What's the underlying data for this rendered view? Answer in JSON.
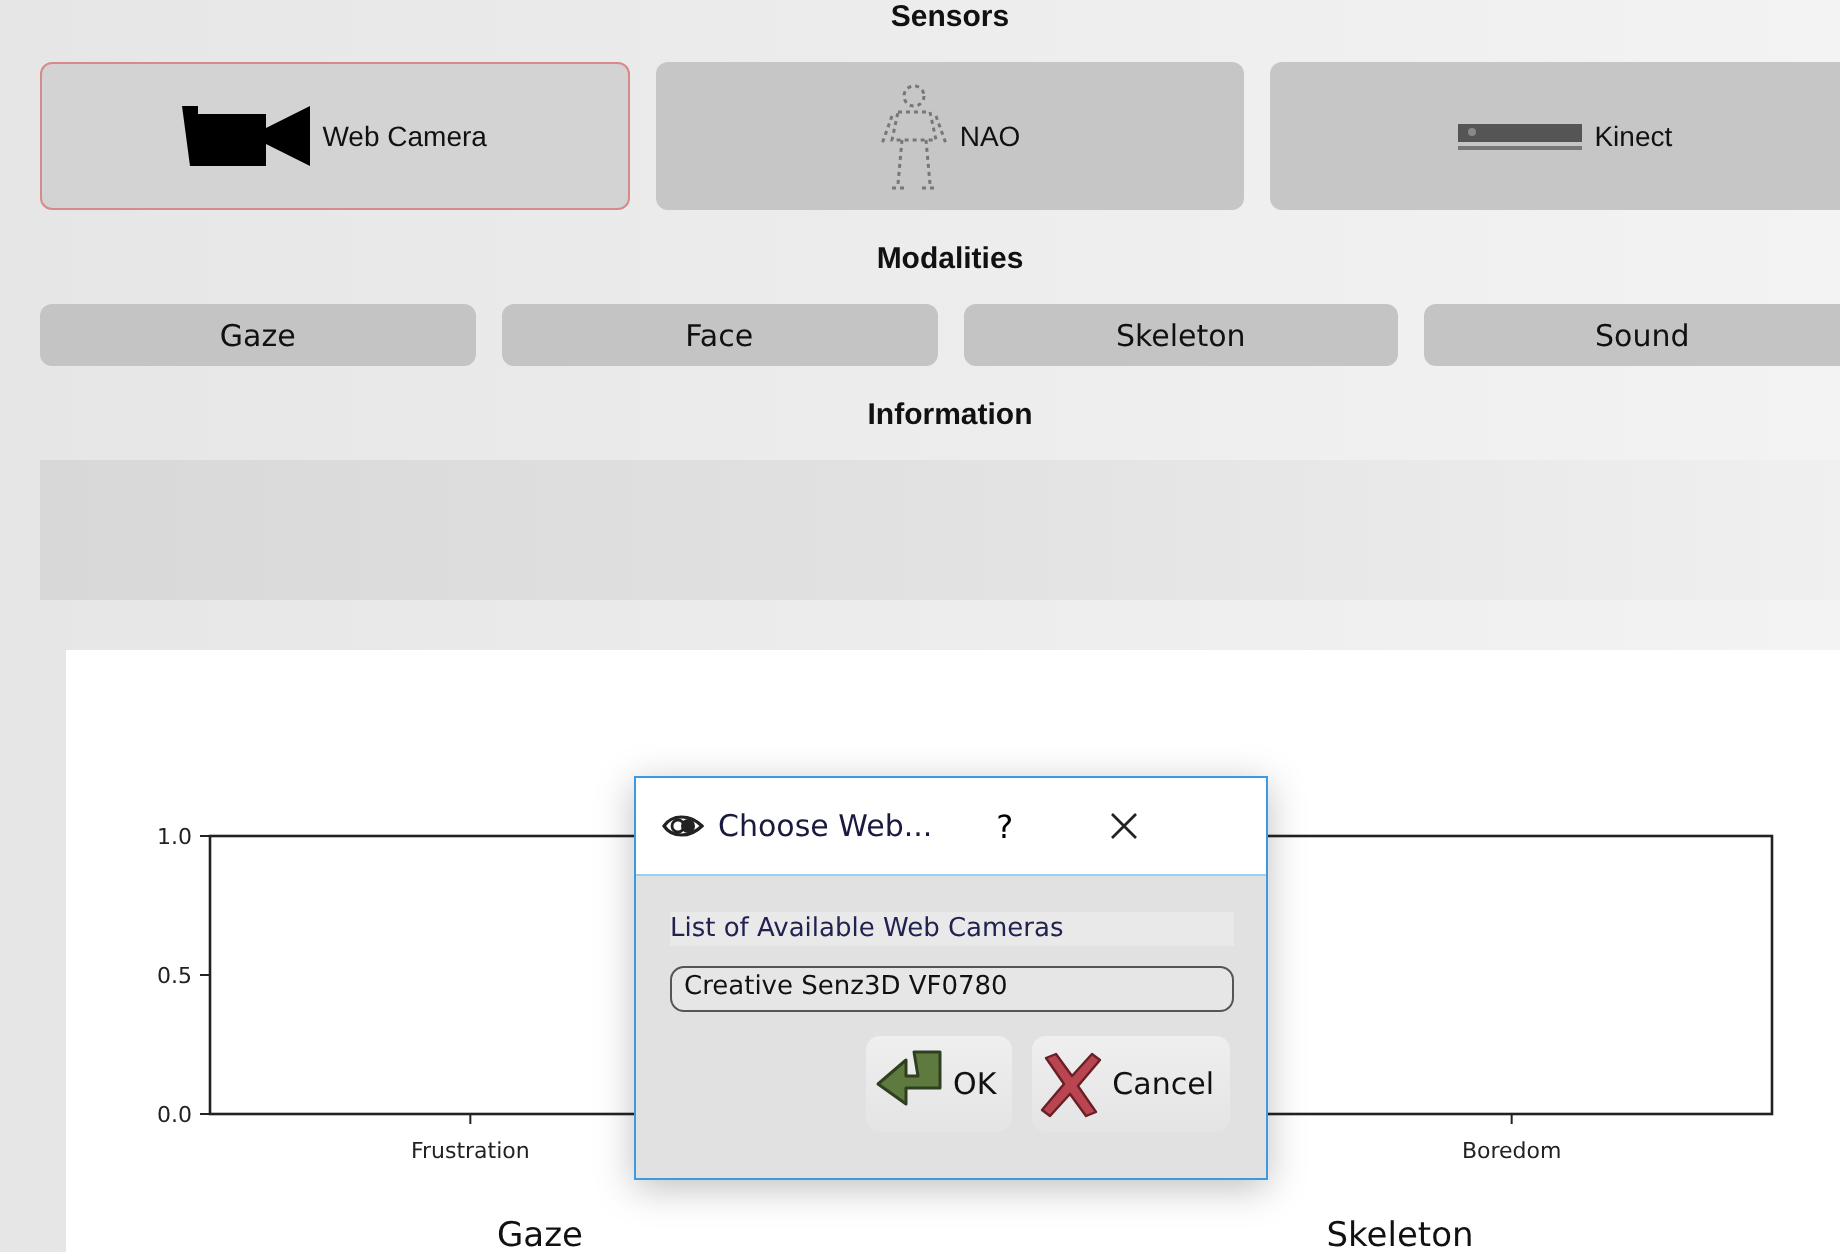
{
  "sensors_heading": "Sensors",
  "sensors": [
    {
      "label": "Web Camera",
      "kind": "camera",
      "selected": true
    },
    {
      "label": "NAO",
      "kind": "robot",
      "selected": false
    },
    {
      "label": "Kinect",
      "kind": "kinect",
      "selected": false
    }
  ],
  "modalities_heading": "Modalities",
  "modalities": [
    {
      "label": "Gaze"
    },
    {
      "label": "Face"
    },
    {
      "label": "Skeleton"
    },
    {
      "label": "Sound"
    }
  ],
  "information_heading": "Information",
  "chart": {
    "chart_data": {
      "type": "bar",
      "categories": [
        "Frustration",
        null,
        "Boredom"
      ],
      "values": [
        0,
        null,
        0
      ],
      "ylim": [
        0,
        1
      ],
      "yticks": [
        {
          "value": 0,
          "label": "0.0"
        },
        {
          "value": 0.5,
          "label": "0.5"
        },
        {
          "value": 1,
          "label": "1.0"
        }
      ]
    },
    "captions": [
      "Gaze",
      "Skeleton"
    ]
  },
  "dialog": {
    "title": "Choose Web...",
    "help": "?",
    "list_label": "List of Available Web Cameras",
    "selection": "Creative Senz3D VF0780",
    "buttons": [
      {
        "label": "OK",
        "kind": "ok"
      },
      {
        "label": "Cancel",
        "kind": "cancel"
      }
    ]
  }
}
